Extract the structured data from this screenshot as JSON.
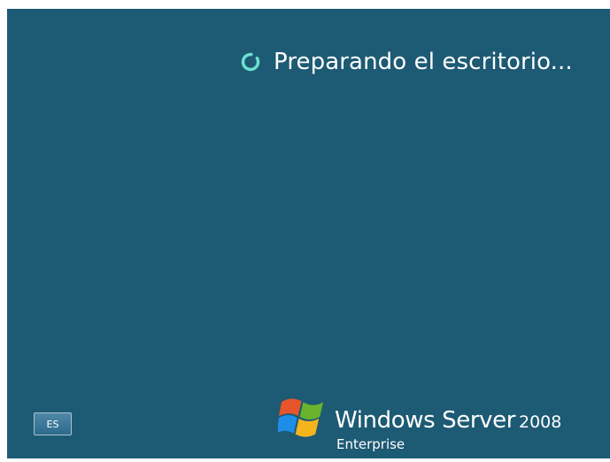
{
  "status": {
    "message": "Preparando el escritorio..."
  },
  "language_button": {
    "label": "ES"
  },
  "branding": {
    "product": "Windows Server",
    "version": "2008",
    "edition": "Enterprise"
  },
  "icons": {
    "spinner": "loading-spinner-icon",
    "logo": "windows-flag-logo"
  },
  "colors": {
    "background": "#1d5a74",
    "text": "#ffffff",
    "spinner": "#6ee0d0",
    "button": "#3f7b9c"
  }
}
